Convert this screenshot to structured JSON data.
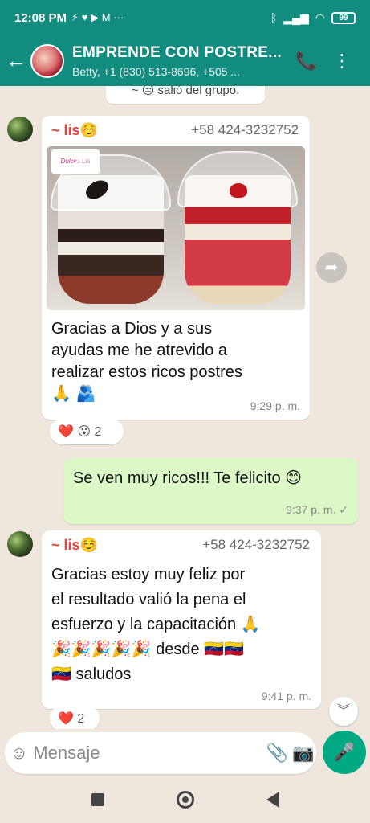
{
  "status": {
    "time": "12:08 PM",
    "left_icons": "⚡ ♥ ▶ M ···",
    "battery": "99"
  },
  "header": {
    "back": "←",
    "title": "EMPRENDE CON POSTRE...",
    "subtitle": "Betty, +1 (830) 513-8696, +505 ...",
    "call_icon": "📞",
    "menu_icon": "⋮"
  },
  "system": {
    "text": "~ 😒 salió del grupo."
  },
  "messages": [
    {
      "sender": "~ lis☺️",
      "phone": "+58 424-3232752",
      "photo_label": "Dulces Lis",
      "text_lines": [
        "Gracias a Dios y a sus",
        "ayudas me he atrevido a",
        "realizar estos ricos postres",
        "🙏 🫂"
      ],
      "time": "9:29 p. m.",
      "reactions": "❤️ 😮 2"
    },
    {
      "text": "Se ven muy ricos!!! Te felicito 😊",
      "time": "9:37 p. m. ✓"
    },
    {
      "sender": "~ lis☺️",
      "phone": "+58 424-3232752",
      "text_lines": [
        "Gracias estoy muy feliz por",
        "el resultado valió la pena el",
        "esfuerzo y la capacitación 🙏",
        "🎉🎉🎉🎉🎉 desde 🇻🇪🇻🇪",
        "🇻🇪 saludos"
      ],
      "time": "9:41 p. m.",
      "reactions": "❤️ 2"
    }
  ],
  "input": {
    "placeholder": "Mensaje"
  }
}
